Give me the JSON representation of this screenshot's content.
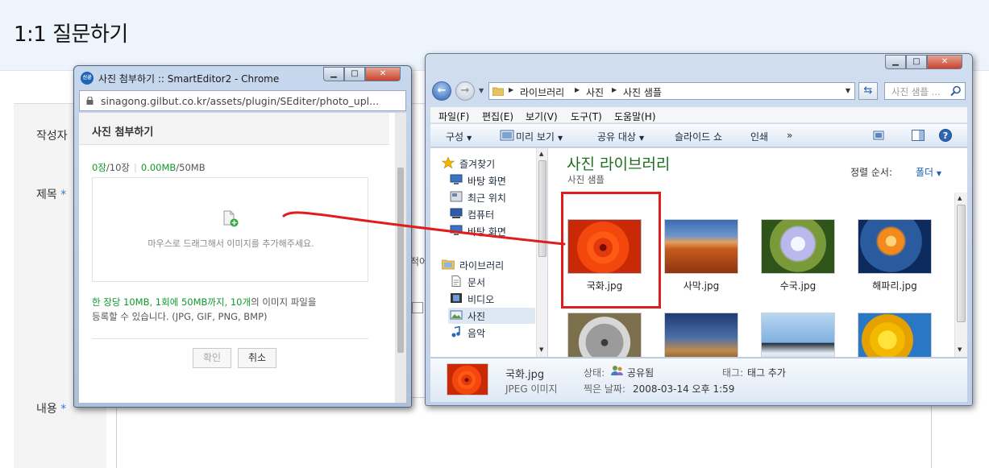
{
  "page": {
    "title": "1:1 질문하기",
    "labels": {
      "author": "작성자",
      "subject": "제목",
      "content": "내용",
      "required_mark": "*"
    },
    "peek_text": "적어"
  },
  "popup": {
    "window_title": "사진 첨부하기 :: SmartEditor2 - Chrome",
    "favicon_text": "신공",
    "url": "sinagong.gilbut.co.kr/assets/plugin/SEditer/photo_upl...",
    "header": "사진 첨부하기",
    "count_current": "0장",
    "count_total": "/10장",
    "size_current": "0.00MB",
    "size_total": "/50MB",
    "drop_text": "마우스로 드래그해서 이미지를 추가해주세요.",
    "note_highlight": "한 장당 10MB, 1회에 50MB까지, 10개",
    "note_rest": "의 이미지 파일을",
    "note_line2": "등록할 수 있습니다. (JPG, GIF, PNG, BMP)",
    "confirm_button": "확인",
    "cancel_button": "취소"
  },
  "explorer": {
    "breadcrumb": [
      "라이브러리",
      "사진",
      "사진 샘플"
    ],
    "search_placeholder": "사진 샘플 ...",
    "menu": [
      "파일(F)",
      "편집(E)",
      "보기(V)",
      "도구(T)",
      "도움말(H)"
    ],
    "toolbar": {
      "organize": "구성",
      "preview": "미리 보기",
      "share": "공유 대상",
      "slideshow": "슬라이드 쇼",
      "print": "인쇄",
      "more": "»"
    },
    "sidebar": [
      {
        "label": "즐겨찾기",
        "icon": "star-icon"
      },
      {
        "label": "바탕 화면",
        "icon": "desktop-icon"
      },
      {
        "label": "최근 위치",
        "icon": "recent-places-icon"
      },
      {
        "label": "컴퓨터",
        "icon": "computer-icon"
      },
      {
        "label": "바탕 화면",
        "icon": "desktop-icon"
      },
      {
        "label": "라이브러리",
        "icon": "library-icon"
      },
      {
        "label": "문서",
        "icon": "documents-icon"
      },
      {
        "label": "비디오",
        "icon": "video-icon"
      },
      {
        "label": "사진",
        "icon": "pictures-icon"
      },
      {
        "label": "음악",
        "icon": "music-icon"
      }
    ],
    "library_title": "사진 라이브러리",
    "library_subtitle": "사진 샘플",
    "sort_label": "정렬 순서:",
    "sort_value": "폴더",
    "files": [
      {
        "name": "국화.jpg",
        "photo": "flower"
      },
      {
        "name": "사막.jpg",
        "photo": "desert"
      },
      {
        "name": "수국.jpg",
        "photo": "hydrangea"
      },
      {
        "name": "해파리.jpg",
        "photo": "jellyfish"
      },
      {
        "name": "",
        "photo": "koala"
      },
      {
        "name": "",
        "photo": "lighthouse"
      },
      {
        "name": "",
        "photo": "penguins"
      },
      {
        "name": "",
        "photo": "tulips"
      }
    ],
    "details": {
      "filename": "국화.jpg",
      "filetype": "JPEG 이미지",
      "state_label": "상태:",
      "state_value": "공유됨",
      "tag_label": "태그:",
      "tag_value": "태그 추가",
      "date_label": "찍은 날짜:",
      "date_value": "2008-03-14 오후 1:59"
    }
  },
  "colors": {
    "accent_green": "#0f9a2c",
    "library_green": "#1c6f1c",
    "highlight_red": "#e01c1c",
    "link_blue": "#1d5fb9"
  }
}
